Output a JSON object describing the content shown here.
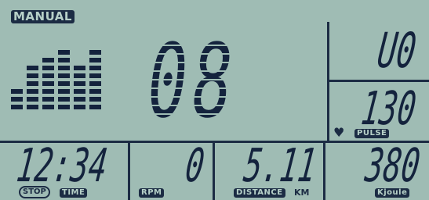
{
  "mode": "MANUAL",
  "big_display": "08",
  "level": "U0",
  "pulse": {
    "value": "130",
    "label": "PULSE"
  },
  "time": {
    "value": "12:34",
    "label": "TIME",
    "stop_label": "STOP"
  },
  "rpm": {
    "value": "0",
    "label": "RPM"
  },
  "distance": {
    "value": "5.11",
    "label": "DISTANCE",
    "unit": "KM"
  },
  "energy": {
    "value": "380",
    "label": "Kjoule"
  },
  "profile_bars": [
    3,
    6,
    7,
    8,
    6,
    8
  ],
  "colors": {
    "lcd_background": "#9fbcb4",
    "segment": "#14233d",
    "label_bg": "#1c2c44"
  }
}
